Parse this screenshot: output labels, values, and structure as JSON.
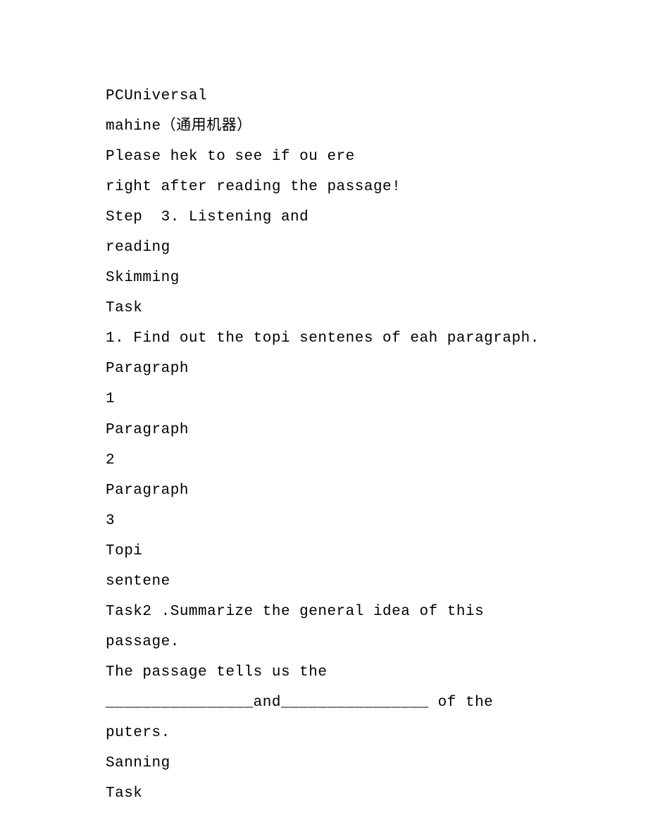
{
  "lines": [
    "PCUniversal",
    "mahine（通用机器）",
    "Please hek to see if ou ere",
    "right after reading the passage!",
    "Step  3. Listening and",
    "reading",
    "Skimming",
    "Task",
    "1. Find out the topi sentenes of eah paragraph.",
    "Paragraph",
    "1",
    "Paragraph",
    "2",
    "Paragraph",
    "3",
    "Topi",
    "sentene",
    "Task2 .Summarize the general idea of this",
    "passage.",
    "The passage tells us the",
    "________________and________________ of the",
    "puters.",
    "Sanning",
    "Task"
  ]
}
